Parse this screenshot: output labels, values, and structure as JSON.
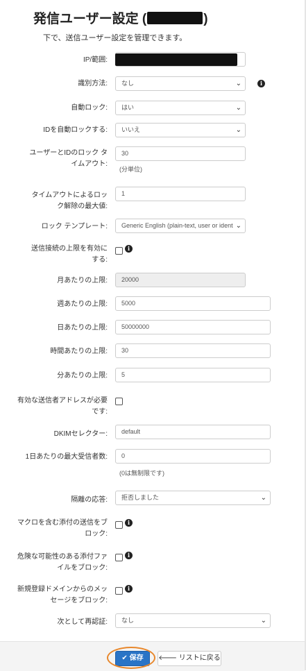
{
  "header": {
    "title": "発信ユーザー設定 (",
    "title_close": ")",
    "subtitle": "下で、送信ユーザー設定を管理できます。"
  },
  "fields": {
    "ip": {
      "label": "IP/範囲:"
    },
    "identify": {
      "label": "識別方法:",
      "value": "なし"
    },
    "autolock": {
      "label": "自動ロック:",
      "value": "はい"
    },
    "id_autolock": {
      "label": "IDを自動ロックする:",
      "value": "いいえ"
    },
    "lock_timeout": {
      "label_1": "ユーザーとIDのロック タ",
      "label_2": "イムアウト:",
      "value": "30",
      "hint": "(分単位)"
    },
    "unlock_max": {
      "label_1": "タイムアウトによるロッ",
      "label_2": "ク解除の最大値:",
      "value": "1"
    },
    "lock_template": {
      "label": "ロック テンプレート:",
      "value": "Generic English (plain-text, user or ident"
    },
    "enable_limit": {
      "label_1": "送信接続の上限を有効に",
      "label_2": "する:"
    },
    "monthly": {
      "label": "月あたりの上限:",
      "value": "20000"
    },
    "weekly": {
      "label": "週あたりの上限:",
      "value": "5000"
    },
    "daily": {
      "label": "日あたりの上限:",
      "value": "50000000"
    },
    "hourly": {
      "label": "時間あたりの上限:",
      "value": "30"
    },
    "minute": {
      "label": "分あたりの上限:",
      "value": "5"
    },
    "valid_sender": {
      "label_1": "有効な送信者アドレスが必要",
      "label_2": "です:"
    },
    "dkim": {
      "label": "DKIMセレクター:",
      "value": "default"
    },
    "max_recipients": {
      "label": "1日あたりの最大受信者数:",
      "value": "0",
      "hint": "(0は無制限です)"
    },
    "quarantine": {
      "label": "隔離の応答:",
      "value": "拒否しました"
    },
    "macro_block": {
      "label_1": "マクロを含む添付の送信をブ",
      "label_2": "ロック:"
    },
    "danger_block": {
      "label_1": "危険な可能性のある添付ファ",
      "label_2": "イルをブロック:"
    },
    "newdomain_block": {
      "label_1": "新規登録ドメインからのメッ",
      "label_2": "セージをブロック:"
    },
    "reauth": {
      "label": "次として再認証:",
      "value": "なし"
    }
  },
  "footer": {
    "save_label": "保存",
    "back_label": "リストに戻る"
  },
  "icons": {
    "save": "check-icon",
    "back": "arrow-left-icon",
    "info": "info-icon",
    "dropdown": "chevron-down-icon"
  },
  "colors": {
    "save_button": "#2a74c6",
    "highlight_ring": "#e8872b"
  }
}
